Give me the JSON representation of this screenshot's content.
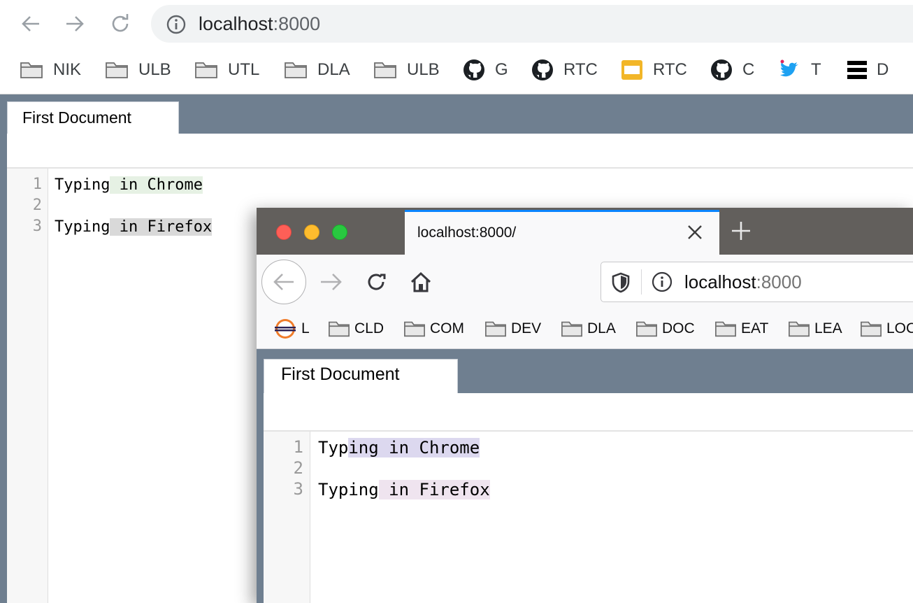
{
  "chrome": {
    "url_host": "localhost",
    "url_port": ":8000",
    "bookmarks": [
      {
        "label": "NIK",
        "icon": "folder-icon"
      },
      {
        "label": "ULB",
        "icon": "folder-icon"
      },
      {
        "label": "UTL",
        "icon": "folder-icon"
      },
      {
        "label": "DLA",
        "icon": "folder-icon"
      },
      {
        "label": "ULB",
        "icon": "folder-icon"
      },
      {
        "label": "G",
        "icon": "github-icon"
      },
      {
        "label": "RTC",
        "icon": "github-icon"
      },
      {
        "label": "RTC",
        "icon": "yellow-window-icon"
      },
      {
        "label": "C",
        "icon": "github-icon"
      },
      {
        "label": "T",
        "icon": "twitter-icon"
      },
      {
        "label": "D",
        "icon": "stack-bars-icon"
      }
    ],
    "app": {
      "tab_label": "First Document",
      "lines": [
        {
          "number": "1",
          "text": "Typing in Chrome",
          "typed": "Typing",
          "highlighted": " in Chrome"
        },
        {
          "number": "2",
          "text": "",
          "typed": "",
          "highlighted": ""
        },
        {
          "number": "3",
          "text": "Typing in Firefox",
          "typed": "Typing",
          "highlighted": " in Firefox"
        }
      ]
    }
  },
  "firefox": {
    "tab_title": "localhost:8000/",
    "url_host": "localhost",
    "url_port": ":8000",
    "bookmarks": [
      {
        "label": "L",
        "icon": "eclipse-icon"
      },
      {
        "label": "CLD",
        "icon": "folder-icon"
      },
      {
        "label": "COM",
        "icon": "folder-icon"
      },
      {
        "label": "DEV",
        "icon": "folder-icon"
      },
      {
        "label": "DLA",
        "icon": "folder-icon"
      },
      {
        "label": "DOC",
        "icon": "folder-icon"
      },
      {
        "label": "EAT",
        "icon": "folder-icon"
      },
      {
        "label": "LEA",
        "icon": "folder-icon"
      },
      {
        "label": "LOC",
        "icon": "folder-icon"
      }
    ],
    "app": {
      "tab_label": "First Document",
      "lines": [
        {
          "number": "1",
          "text": "Typing in Chrome",
          "typed": "Typ",
          "highlighted": "ing in Chrome"
        },
        {
          "number": "2",
          "text": "",
          "typed": "",
          "highlighted": ""
        },
        {
          "number": "3",
          "text": "Typing in Firefox",
          "typed": "Typing",
          "highlighted": " in Firefox"
        }
      ]
    }
  },
  "colors": {
    "chrome_highlight_line1": "#e6f1e4",
    "chrome_highlight_line3": "#d9d9d9",
    "firefox_highlight_line1": "#dcd8ef",
    "firefox_highlight_line3": "#efe4ef",
    "app_header": "#6f7f90",
    "firefox_tab_accent": "#0a84ff"
  }
}
